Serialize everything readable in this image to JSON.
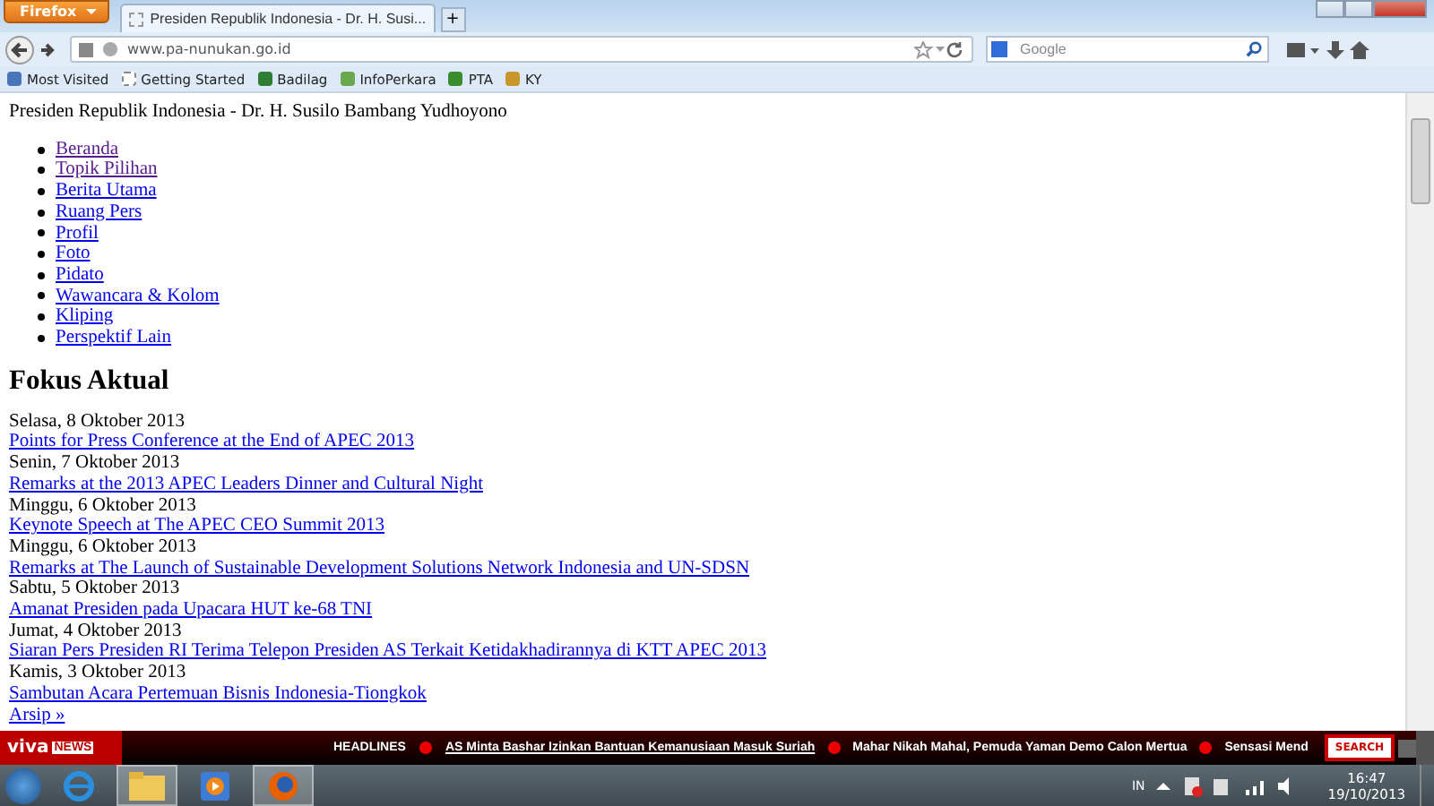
{
  "browser": {
    "menu_button": "Firefox",
    "tab": {
      "title": "Presiden Republik Indonesia - Dr. H. Susi...",
      "selected": true
    },
    "new_tab": "+",
    "address": "www.pa-nunukan.go.id",
    "search": {
      "placeholder": "Google"
    },
    "bookmarks": [
      "Most Visited",
      "Getting Started",
      "Badilag",
      "InfoPerkara",
      "PTA",
      "KY"
    ]
  },
  "page": {
    "site_title": "Presiden Republik Indonesia - Dr. H. Susilo Bambang Yudhoyono",
    "nav": [
      {
        "label": "Beranda",
        "visited": true
      },
      {
        "label": "Topik Pilihan",
        "visited": true
      },
      {
        "label": "Berita Utama",
        "visited": false
      },
      {
        "label": "Ruang Pers",
        "visited": false
      },
      {
        "label": "Profil",
        "visited": false
      },
      {
        "label": "Foto",
        "visited": false
      },
      {
        "label": "Pidato",
        "visited": false
      },
      {
        "label": "Wawancara & Kolom",
        "visited": false
      },
      {
        "label": "Kliping",
        "visited": false
      },
      {
        "label": "Perspektif Lain",
        "visited": false
      }
    ],
    "heading": "Fokus Aktual",
    "entries": [
      {
        "date": "Selasa, 8 Oktober 2013",
        "title": "Points for Press Conference at the End of APEC 2013"
      },
      {
        "date": "Senin, 7 Oktober 2013",
        "title": "Remarks at the 2013 APEC Leaders Dinner and Cultural Night"
      },
      {
        "date": "Minggu, 6 Oktober 2013",
        "title": "Keynote Speech at The APEC CEO Summit 2013"
      },
      {
        "date": "Minggu, 6 Oktober 2013",
        "title": "Remarks at The Launch of Sustainable Development Solutions Network Indonesia and UN-SDSN"
      },
      {
        "date": "Sabtu, 5 Oktober 2013",
        "title": "Amanat Presiden pada Upacara HUT ke-68 TNI"
      },
      {
        "date": "Jumat, 4 Oktober 2013",
        "title": "Siaran Pers Presiden RI Terima Telepon Presiden AS Terkait Ketidakhadirannya di KTT APEC 2013"
      },
      {
        "date": "Kamis, 3 Oktober 2013",
        "title": "Sambutan Acara Pertemuan Bisnis Indonesia-Tiongkok"
      }
    ],
    "archive": "Arsip »"
  },
  "ticker": {
    "logo_viva": "viva",
    "logo_news": "NEWS",
    "label": "HEADLINES",
    "headlines": [
      "AS Minta Bashar Izinkan Bantuan Kemanusiaan Masuk Suriah",
      "Mahar Nikah Mahal, Pemuda Yaman Demo Calon Mertua",
      "Sensasi Mend"
    ],
    "search": "SEARCH"
  },
  "taskbar": {
    "language": "IN",
    "time": "16:47",
    "date": "19/10/2013"
  }
}
